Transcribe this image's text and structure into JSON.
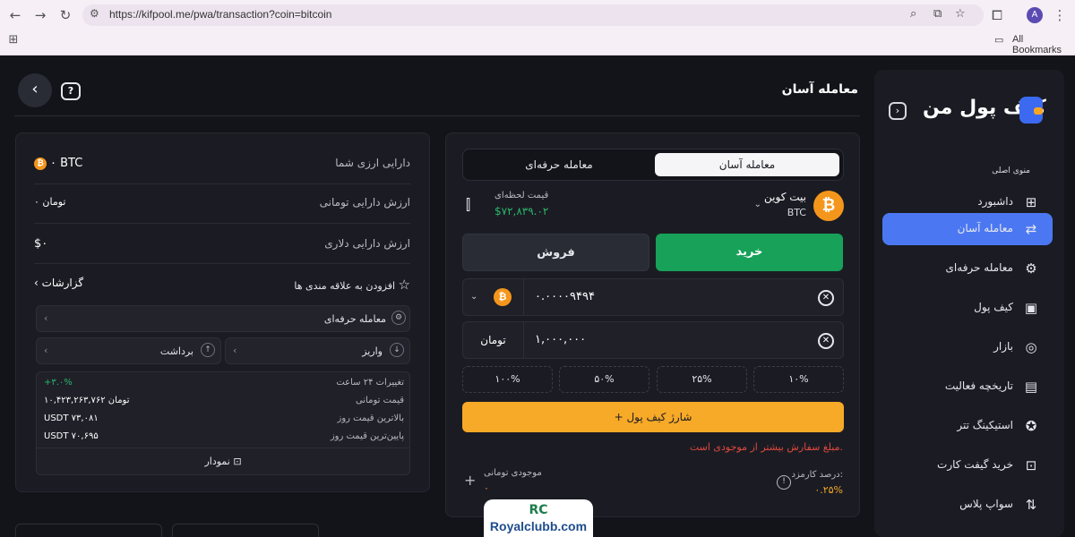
{
  "browser": {
    "url": "https://kifpool.me/pwa/transaction?coin=bitcoin",
    "avatar_letter": "A",
    "bookmarks_label": "All Bookmarks"
  },
  "sidebar": {
    "logo": "کیف پول من",
    "menu_title": "منوی اصلی",
    "items": [
      {
        "label": "داشبورد",
        "icon": "dashboard-icon"
      },
      {
        "label": "معامله آسان",
        "icon": "easy-trade-icon"
      },
      {
        "label": "معامله حرفه‌ای",
        "icon": "pro-trade-icon"
      },
      {
        "label": "کیف پول",
        "icon": "wallet-icon"
      },
      {
        "label": "بازار",
        "icon": "market-icon"
      },
      {
        "label": "تاریخچه فعالیت",
        "icon": "history-icon"
      },
      {
        "label": "استیکینگ تتر",
        "icon": "staking-icon"
      },
      {
        "label": "خرید گیفت کارت",
        "icon": "gift-icon"
      },
      {
        "label": "سواپ پلاس",
        "icon": "swap-icon"
      }
    ]
  },
  "header": {
    "title": "معامله آسان"
  },
  "trade": {
    "tab_easy": "معامله آسان",
    "tab_pro": "معامله حرفه‌ای",
    "coin_name": "بیت کوین",
    "coin_symbol": "BTC",
    "price_label": "قیمت لحظه‌ای",
    "price_value": "$۷۲,۸۳۹.۰۲",
    "buy_label": "خرید",
    "sell_label": "فروش",
    "btc_amount": "۰.۰۰۰۰۹۴۹۴",
    "toman_amount": "۱,۰۰۰,۰۰۰",
    "toman_unit": "تومان",
    "percents": [
      "۱۰%",
      "۲۵%",
      "۵۰%",
      "۱۰۰%"
    ],
    "charge_label": "شارژ کیف پول",
    "warning": "مبلغ سفارش بیشتر از موجودی است.",
    "fee_label": "درصد کارمزد:",
    "fee_value": "۰.۲۵%",
    "balance_label": "موجودی تومانی",
    "balance_value": "۰"
  },
  "assets": {
    "crypto_label": "دارایی ارزی شما",
    "crypto_value": "۰ BTC",
    "toman_label": "ارزش دارایی تومانی",
    "toman_value": "۰ تومان",
    "dollar_label": "ارزش دارایی دلاری",
    "dollar_value": "$۰",
    "favorites_label": "افزودن به علاقه مندی ها",
    "reports_label": "گزارشات",
    "pro_trade_label": "معامله حرفه‌ای",
    "deposit_label": "واریز",
    "withdraw_label": "برداشت",
    "stats": [
      {
        "label": "تغییرات ۲۴ ساعت",
        "value": "+۳.۰%"
      },
      {
        "label": "قیمت تومانی",
        "value": "۱۰,۴۲۳,۲۶۳,۷۶۲ تومان"
      },
      {
        "label": "بالاترین قیمت روز",
        "value": "USDT ۷۳,۰۸۱"
      },
      {
        "label": "پایین‌ترین قیمت روز",
        "value": "USDT ۷۰,۶۹۵"
      }
    ],
    "chart_label": "نمودار"
  },
  "watermark": {
    "mark": "RC",
    "text": "Royalclubb.com"
  },
  "colors": {
    "accent": "#4b78f2",
    "buy": "#18a158",
    "charge": "#f7a928",
    "warning": "#e0483e",
    "positive": "#2ab56a"
  }
}
